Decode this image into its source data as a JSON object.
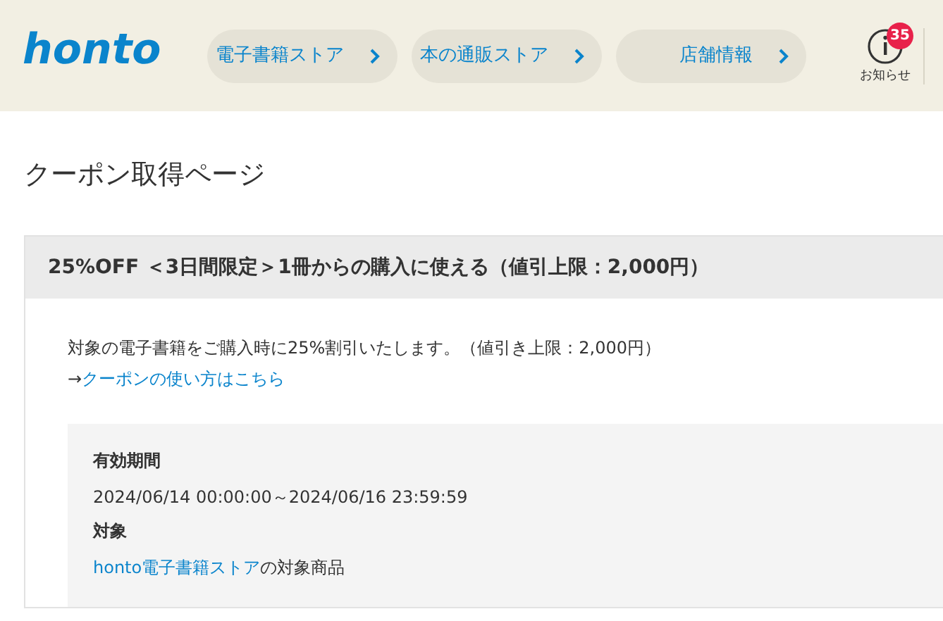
{
  "header": {
    "logo": "honto",
    "nav": [
      {
        "label": "電子書籍ストア"
      },
      {
        "label": "本の通販ストア"
      },
      {
        "label": "店舗情報"
      }
    ],
    "notifications": {
      "count": "35",
      "label": "お知らせ"
    }
  },
  "page_title": "クーポン取得ページ",
  "coupon": {
    "title": "25%OFF ＜3日間限定＞1冊からの購入に使える（値引上限：2,000円）",
    "description": "対象の電子書籍をご購入時に25%割引いたします。（値引き上限：2,000円）",
    "arrow": "→",
    "link": "クーポンの使い方はこちら",
    "details": [
      {
        "heading": "有効期間",
        "value": "2024/06/14 00:00:00～2024/06/16 23:59:59"
      },
      {
        "heading": "対象",
        "link": "honto電子書籍ストア",
        "value": "の対象商品"
      }
    ]
  }
}
